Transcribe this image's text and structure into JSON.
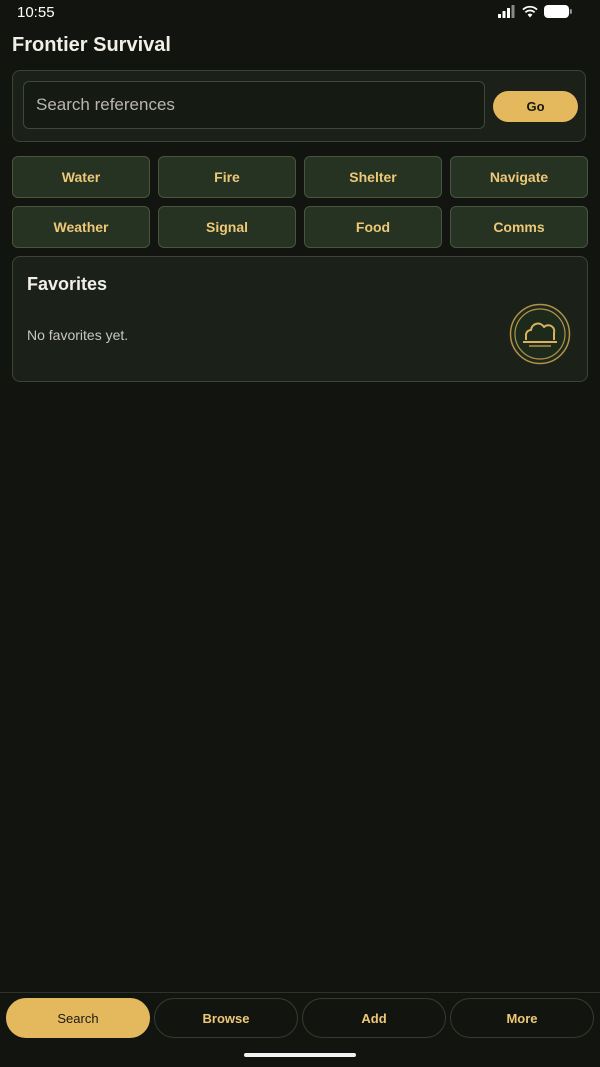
{
  "status_bar": {
    "time": "10:55",
    "icons": [
      "signal-icon",
      "wifi-icon",
      "battery-icon"
    ]
  },
  "header": {
    "title": "Frontier Survival"
  },
  "search": {
    "placeholder": "Search references",
    "value": "",
    "go_label": "Go"
  },
  "categories": [
    {
      "label": "Water"
    },
    {
      "label": "Fire"
    },
    {
      "label": "Shelter"
    },
    {
      "label": "Navigate"
    },
    {
      "label": "Weather"
    },
    {
      "label": "Signal"
    },
    {
      "label": "Food"
    },
    {
      "label": "Comms"
    }
  ],
  "favorites": {
    "title": "Favorites",
    "empty_text": "No favorites yet.",
    "emblem_icon": "cloud-emblem-icon"
  },
  "bottom_nav": {
    "tabs": [
      {
        "label": "Search",
        "active": true
      },
      {
        "label": "Browse",
        "active": false
      },
      {
        "label": "Add",
        "active": false
      },
      {
        "label": "More",
        "active": false
      }
    ]
  },
  "colors": {
    "background": "#12150f",
    "panel": "#1b2119",
    "accent": "#e4b95e",
    "category_bg": "#263222",
    "category_text": "#ecc877"
  }
}
